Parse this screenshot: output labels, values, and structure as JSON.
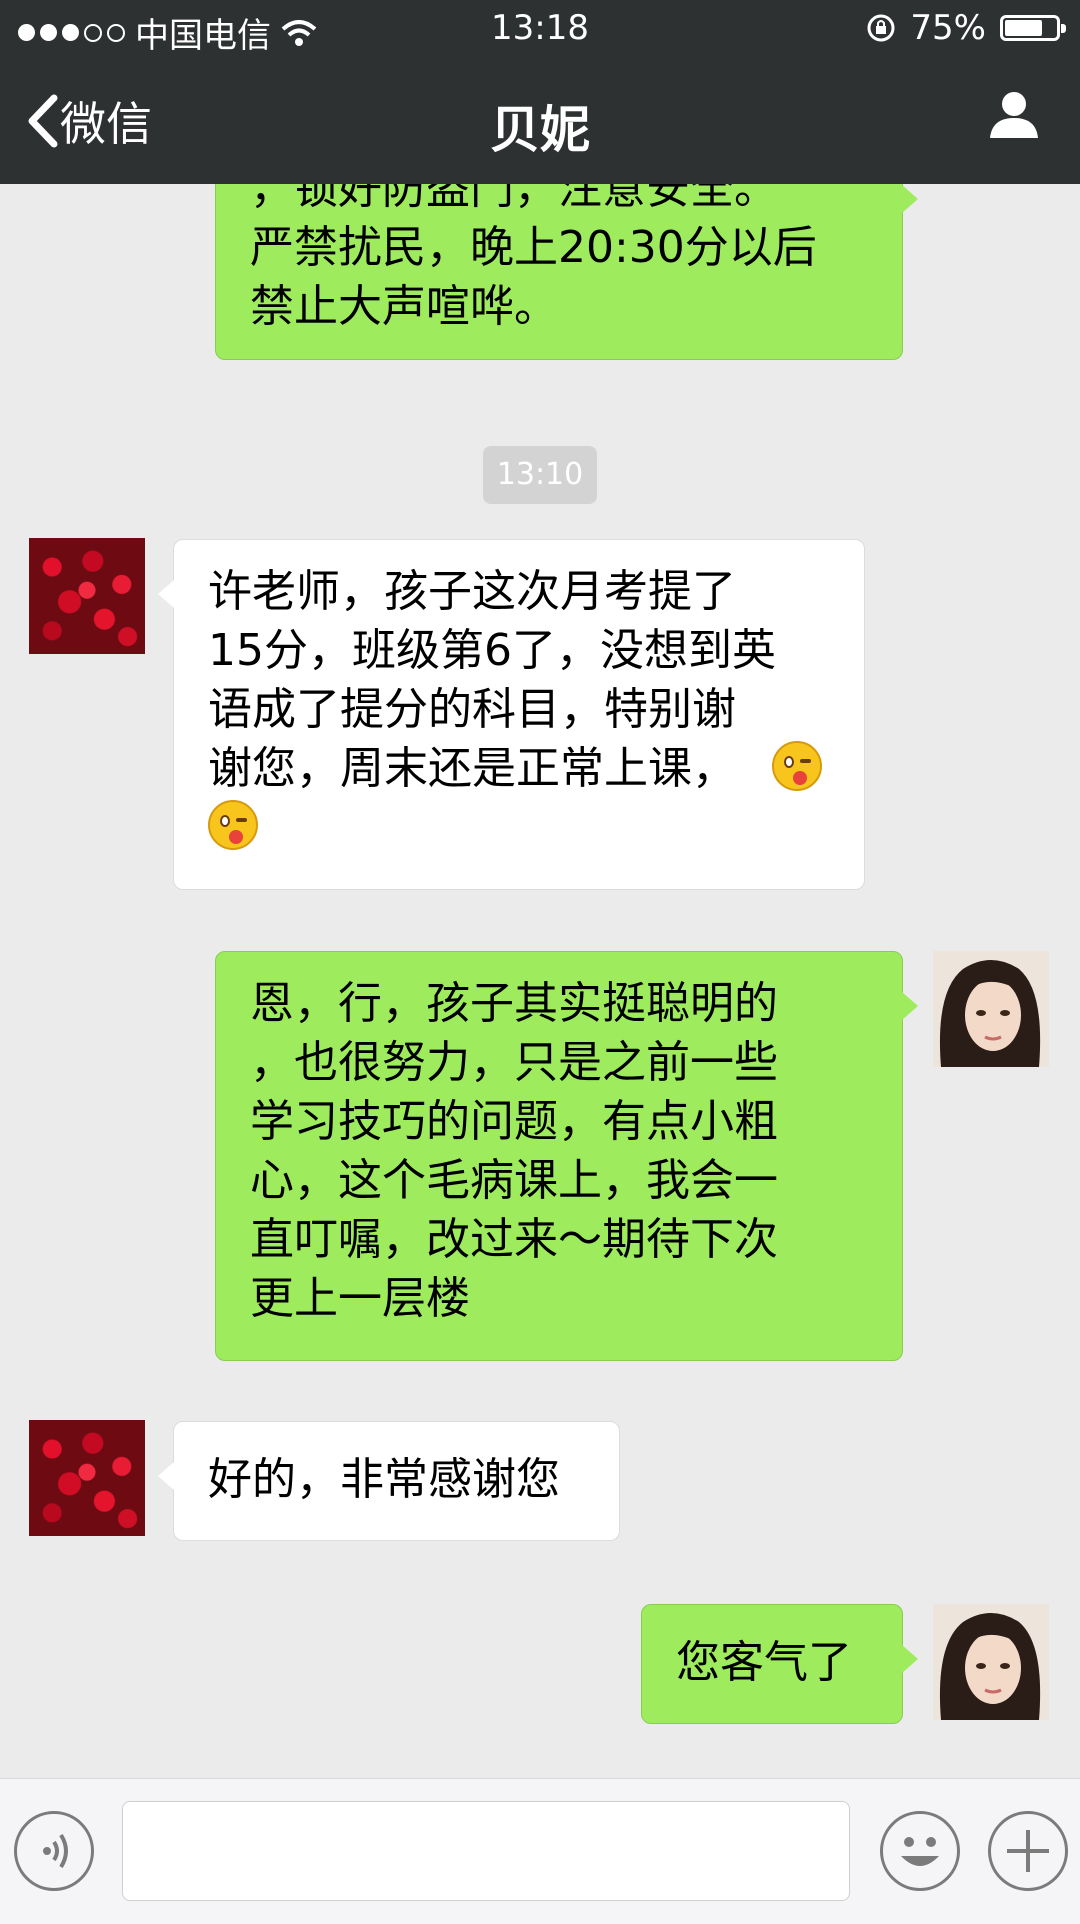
{
  "status_bar": {
    "carrier": "中国电信",
    "time": "13:18",
    "battery": "75%",
    "battery_level": 0.75
  },
  "nav": {
    "back_label": "微信",
    "title": "贝妮"
  },
  "messages": {
    "m1": {
      "sender": "self",
      "line1": "，锁好防盗门，注意安全。",
      "line2": " 严禁扰民，晚上20:30分以后",
      "line3": "禁止大声喧哗。"
    },
    "timestamp": "13:10",
    "m2": {
      "sender": "contact",
      "line1": "许老师，孩子这次月考提了",
      "line2": "15分，班级第6了，没想到英",
      "line3": "语成了提分的科目，特别谢",
      "line4": "谢您，周末还是正常上课，"
    },
    "m3": {
      "sender": "self",
      "line1": "恩，行，孩子其实挺聪明的",
      "line2": "，也很努力，只是之前一些",
      "line3": "学习技巧的问题，有点小粗",
      "line4": "心，这个毛病课上，我会一",
      "line5": "直叮嘱，改过来～期待下次",
      "line6": "更上一层楼"
    },
    "m4": {
      "sender": "contact",
      "text": "好的，非常感谢您"
    },
    "m5": {
      "sender": "self",
      "text": "您客气了"
    }
  },
  "icons": {
    "back": "chevron-left-icon",
    "profile": "person-icon",
    "voice": "voice-icon",
    "emoji": "smiley-icon",
    "more": "plus-icon",
    "emoji_in_message": "winking-tongue-emoji"
  },
  "colors": {
    "header_bg": "#2e3132",
    "chat_bg": "#ebebeb",
    "outgoing_bubble": "#9feb5e",
    "incoming_bubble": "#ffffff"
  }
}
